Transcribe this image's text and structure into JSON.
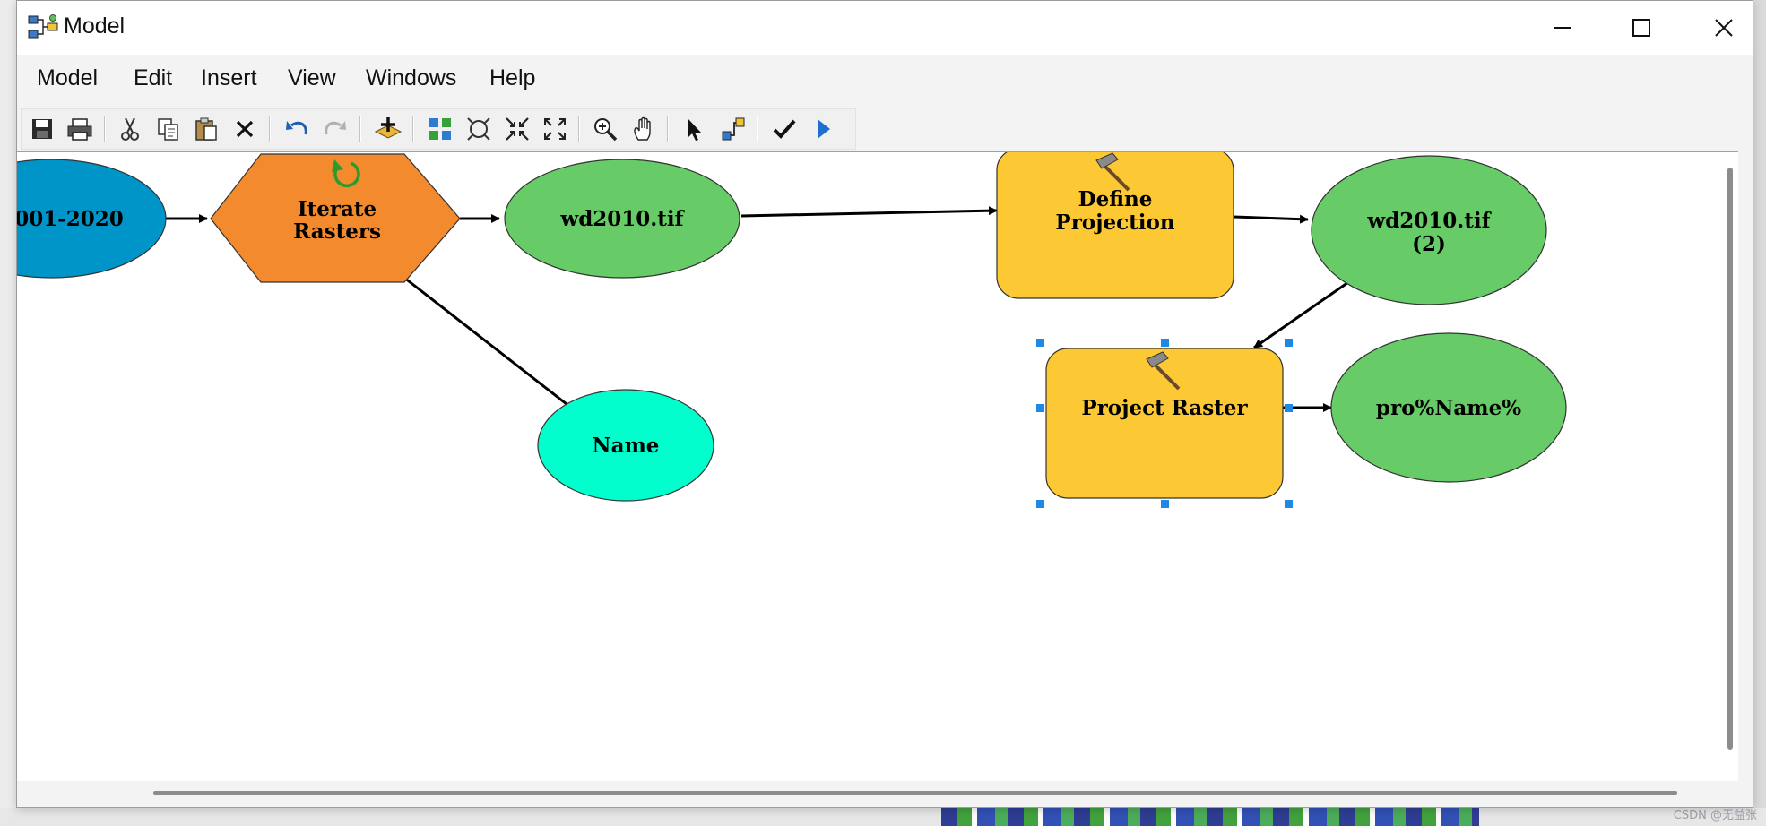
{
  "window": {
    "title": "Model"
  },
  "menu": [
    "Model",
    "Edit",
    "Insert",
    "View",
    "Windows",
    "Help"
  ],
  "toolbar": {
    "icons": [
      "save-icon",
      "print-icon",
      "cut-icon",
      "copy-icon",
      "paste-icon",
      "delete-icon",
      "undo-icon",
      "redo-icon",
      "add-data-icon",
      "auto-layout-icon",
      "full-extent-icon",
      "zoom-in-fixed-icon",
      "zoom-out-fixed-icon",
      "zoom-icon",
      "pan-icon",
      "select-icon",
      "connect-icon",
      "validate-icon",
      "run-icon"
    ]
  },
  "diagram": {
    "nodes": {
      "input_raster": "001-2020",
      "iterate": [
        "Iterate",
        "Rasters"
      ],
      "wd2010": "wd2010.tif",
      "name": "Name",
      "define": [
        "Define",
        "Projection"
      ],
      "wd2010_2": [
        "wd2010.tif",
        "(2)"
      ],
      "project": "Project Raster",
      "output": "pro%Name%"
    }
  },
  "watermark": "CSDN @无益张",
  "colors": {
    "variable_blue": "#0095c8",
    "iterator_orange": "#f38a2e",
    "derived_green": "#67cb67",
    "value_cyan": "#00ffcc",
    "tool_yellow": "#fcc833",
    "selection_handle": "#1e88e5"
  }
}
